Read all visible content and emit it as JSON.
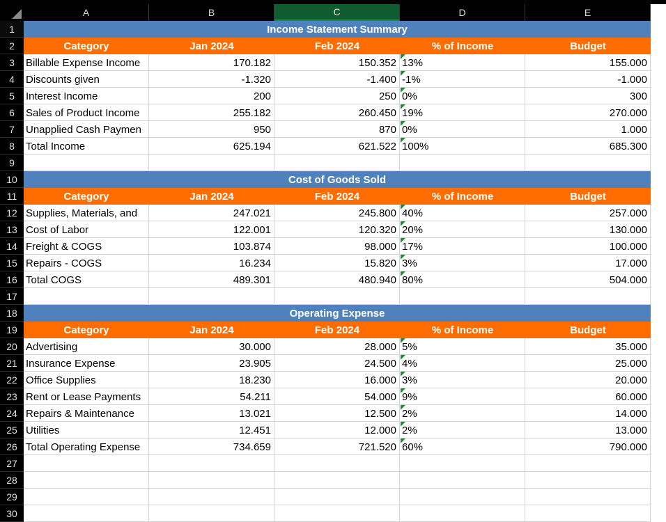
{
  "columns": [
    "A",
    "B",
    "C",
    "D",
    "E"
  ],
  "rows": [
    "1",
    "2",
    "3",
    "4",
    "5",
    "6",
    "7",
    "8",
    "9",
    "10",
    "11",
    "12",
    "13",
    "14",
    "15",
    "16",
    "17",
    "18",
    "19",
    "20",
    "21",
    "22",
    "23",
    "24",
    "25",
    "26",
    "27",
    "28",
    "29",
    "30"
  ],
  "sections": [
    {
      "title": "Income Statement Summary",
      "headers": [
        "Category",
        "Jan 2024",
        "Feb 2024",
        "% of Income",
        "Budget"
      ],
      "rows": [
        [
          "Billable Expense Income",
          "170.182",
          "150.352",
          "13%",
          "155.000"
        ],
        [
          "Discounts given",
          "-1.320",
          "-1.400",
          "-1%",
          "-1.000"
        ],
        [
          "Interest Income",
          "200",
          "250",
          "0%",
          "300"
        ],
        [
          "Sales of Product Income",
          "255.182",
          "260.450",
          "19%",
          "270.000"
        ],
        [
          "Unapplied Cash Paymen",
          "950",
          "870",
          "0%",
          "1.000"
        ],
        [
          "Total Income",
          "625.194",
          "621.522",
          "100%",
          "685.300"
        ]
      ]
    },
    {
      "title": "Cost of Goods Sold",
      "headers": [
        "Category",
        "Jan 2024",
        "Feb 2024",
        "% of Income",
        "Budget"
      ],
      "rows": [
        [
          "Supplies, Materials, and",
          "247.021",
          "245.800",
          "40%",
          "257.000"
        ],
        [
          "Cost of Labor",
          "122.001",
          "120.320",
          "20%",
          "130.000"
        ],
        [
          "Freight & COGS",
          "103.874",
          "98.000",
          "17%",
          "100.000"
        ],
        [
          "Repairs - COGS",
          "16.234",
          "15.820",
          "3%",
          "17.000"
        ],
        [
          "Total COGS",
          "489.301",
          "480.940",
          "80%",
          "504.000"
        ]
      ]
    },
    {
      "title": "Operating Expense",
      "headers": [
        "Category",
        "Jan 2024",
        "Feb 2024",
        "% of Income",
        "Budget"
      ],
      "rows": [
        [
          "Advertising",
          "30.000",
          "28.000",
          "5%",
          "35.000"
        ],
        [
          "Insurance Expense",
          "23.905",
          "24.500",
          "4%",
          "25.000"
        ],
        [
          "Office Supplies",
          "18.230",
          "16.000",
          "3%",
          "20.000"
        ],
        [
          "Rent or Lease Payments",
          "54.211",
          "54.000",
          "9%",
          "60.000"
        ],
        [
          "Repairs & Maintenance",
          "13.021",
          "12.500",
          "2%",
          "14.000"
        ],
        [
          "Utilities",
          "12.451",
          "12.000",
          "2%",
          "13.000"
        ],
        [
          "Total Operating Expense",
          "734.659",
          "721.520",
          "60%",
          "790.000"
        ]
      ]
    }
  ],
  "selected_column": "C",
  "colors": {
    "title_blue": "#4f81bd",
    "header_orange": "#ff6d00",
    "flag_green": "#1e8b3a",
    "selected_header": "#0e5c2f"
  }
}
